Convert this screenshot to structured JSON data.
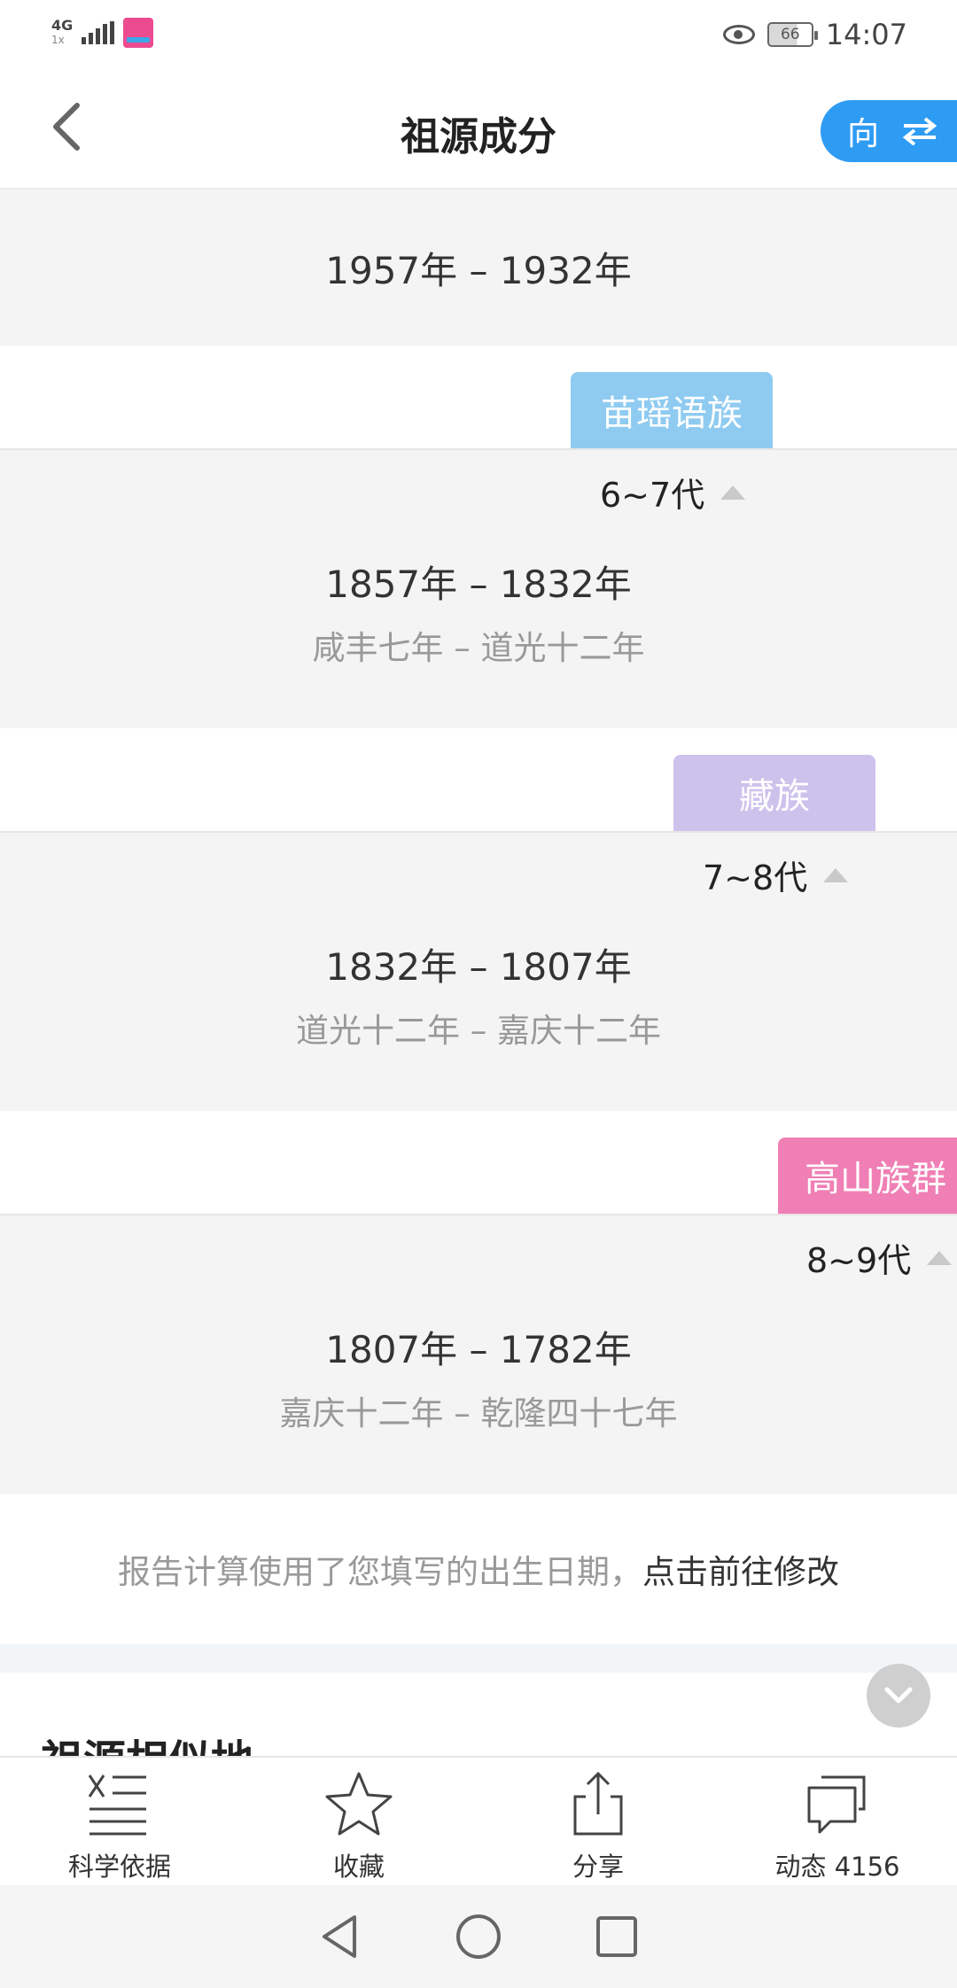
{
  "status_bar": {
    "network": "4G",
    "network_sub": "1x",
    "battery": "66",
    "time": "14:07"
  },
  "header": {
    "title": "祖源成分",
    "direction_label": "向"
  },
  "top_block": {
    "years": "1957年 – 1932年"
  },
  "generations": [
    {
      "tag": "苗瑶语族",
      "tag_color": "#8fcbf1",
      "label": "6~7代",
      "years": "1857年 – 1832年",
      "era": "咸丰七年 – 道光十二年"
    },
    {
      "tag": "藏族",
      "tag_color": "#cdc2ec",
      "label": "7~8代",
      "years": "1832年 – 1807年",
      "era": "道光十二年 – 嘉庆十二年"
    },
    {
      "tag": "高山族群",
      "tag_color": "#ef7fb4",
      "label": "8~9代",
      "years": "1807年 – 1782年",
      "era": "嘉庆十二年 – 乾隆四十七年"
    }
  ],
  "notice": {
    "text": "报告计算使用了您填写的出生日期，",
    "link": "点击前往修改"
  },
  "similar_section": {
    "title": "祖源相似地"
  },
  "bottom_bar": {
    "items": [
      {
        "label": "科学依据",
        "icon": "science-icon"
      },
      {
        "label": "收藏",
        "icon": "star-icon"
      },
      {
        "label": "分享",
        "icon": "share-icon"
      },
      {
        "label": "动态 4156",
        "icon": "chat-icon"
      }
    ]
  },
  "nav_bar": {
    "icons": [
      "back-triangle-icon",
      "home-circle-icon",
      "recents-square-icon"
    ]
  }
}
